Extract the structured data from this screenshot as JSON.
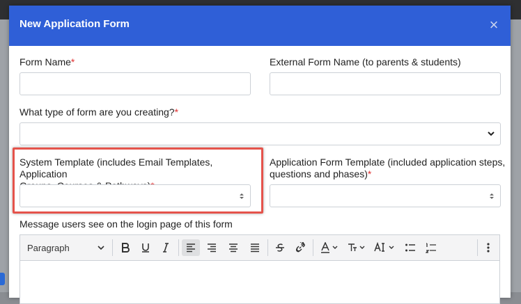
{
  "modal": {
    "title": "New Application Form",
    "close_label": "×"
  },
  "form": {
    "form_name": {
      "label": "Form Name",
      "required_mark": "*",
      "value": ""
    },
    "external_name": {
      "label": "External Form Name (to parents & students)",
      "value": ""
    },
    "form_type": {
      "label": "What type of form are you creating?",
      "required_mark": "*",
      "selected": ""
    },
    "system_template": {
      "label_line1": "System Template (includes Email Templates, Application",
      "label_line2": "Groups, Courses & Pathways)",
      "required_mark": "*",
      "selected": ""
    },
    "app_template": {
      "label_line1": "Application Form Template (included application steps,",
      "label_line2": "questions and phases)",
      "required_mark": "*",
      "selected": ""
    },
    "login_message": {
      "label": "Message users see on the login page of this form"
    }
  },
  "editor": {
    "block_format": "Paragraph",
    "icons": [
      "bold-icon",
      "underline-icon",
      "italic-icon",
      "align-left-icon",
      "align-right-icon",
      "align-center-icon",
      "align-justify-icon",
      "strikethrough-icon",
      "link-icon",
      "font-color-icon",
      "font-size-icon",
      "text-size-icon",
      "bulleted-list-icon",
      "numbered-list-icon",
      "more-icon"
    ]
  },
  "colors": {
    "header": "#2f5fd7",
    "highlight": "#e5534b",
    "required": "#e03030"
  }
}
